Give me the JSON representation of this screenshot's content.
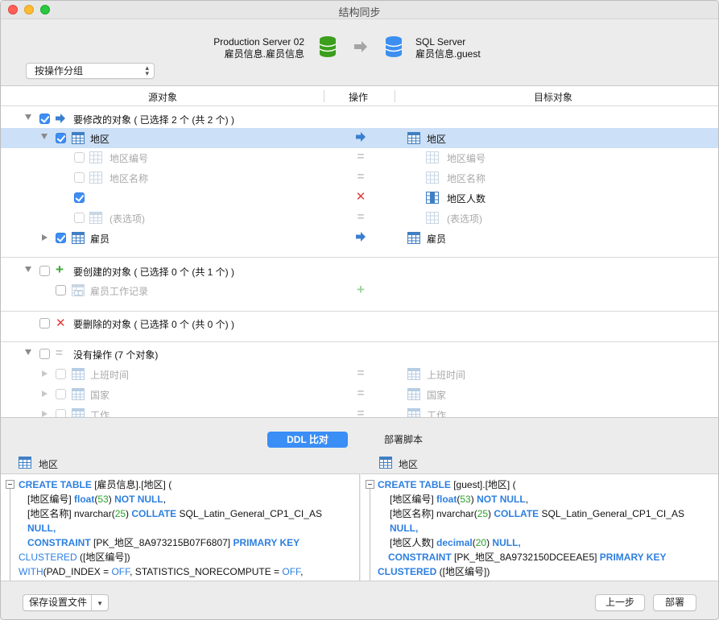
{
  "window": {
    "title": "结构同步"
  },
  "header": {
    "source_server": "Production Server 02",
    "source_schema": "雇员信息.雇员信息",
    "target_server": "SQL Server",
    "target_schema": "雇员信息.guest",
    "group_select": "按操作分组"
  },
  "columns": {
    "source": "源对象",
    "operation": "操作",
    "target": "目标对象"
  },
  "tree": {
    "modify_group": "要修改的对象 ( 已选择 2 个 (共 2 个) )",
    "modify_table": "地区",
    "modify_table_target": "地区",
    "field1": "地区编号",
    "field1_target": "地区编号",
    "field2": "地区名称",
    "field2_target": "地区名称",
    "field3_target": "地区人数",
    "options": "(表选项)",
    "options_target": "(表选项)",
    "employee": "雇员",
    "employee_target": "雇员",
    "create_group": "要创建的对象 ( 已选择 0 个 (共 1 个) )",
    "create_item": "雇员工作记录",
    "delete_group": "要删除的对象 ( 已选择 0 个 (共 0 个) )",
    "noop_group": "没有操作 (7 个对象)",
    "noop1": "上班时间",
    "noop1_target": "上班时间",
    "noop2": "国家",
    "noop2_target": "国家",
    "noop3": "工作",
    "noop3_target": "工作"
  },
  "tabs": {
    "ddl": "DDL 比对",
    "deploy_script": "部署脚本"
  },
  "ddl": {
    "left_title": "地区",
    "right_title": "地区",
    "left": {
      "l1a": "CREATE TABLE",
      "l1b": " [雇员信息].[地区] (",
      "l2a": "[地区编号] ",
      "l2b": "float",
      "l2c": "(",
      "l2d": "53",
      "l2e": ")  ",
      "l2f": "NOT NULL",
      "l3a": "[地区名称] nvarchar(",
      "l3b": "25",
      "l3c": ")  ",
      "l3d": "COLLATE",
      "l3e": " SQL_Latin_General_CP1_CI_AS",
      "l4": "NULL,",
      "l5a": "CONSTRAINT",
      "l5b": " [PK_地区_8A973215B07F6807]  ",
      "l5c": "PRIMARY KEY",
      "l6a": "CLUSTERED",
      "l6b": " ([地区编号])",
      "l7a": "WITH",
      "l7b": "(PAD_INDEX = ",
      "l7c": "OFF",
      "l7d": ", STATISTICS_NORECOMPUTE = ",
      "l7e": "OFF",
      "l7f": ","
    },
    "right": {
      "l1a": "CREATE TABLE",
      "l1b": " [guest].[地区] (",
      "l2a": "[地区编号] ",
      "l2b": "float",
      "l2c": "(",
      "l2d": "53",
      "l2e": ")  ",
      "l2f": "NOT NULL",
      "l3a": "[地区名称] nvarchar(",
      "l3b": "25",
      "l3c": ")  ",
      "l3d": "COLLATE",
      "l3e": " SQL_Latin_General_CP1_CI_AS",
      "l4": "NULL,",
      "l5a": "[地区人数] ",
      "l5b": "decimal",
      "l5c": "(",
      "l5d": "20",
      "l5e": ")  ",
      "l5f": "NULL,",
      "l6a": "CONSTRAINT",
      "l6b": " [PK_地区_8A9732150DCEEAE5]  ",
      "l6c": "PRIMARY KEY",
      "l7a": "CLUSTERED",
      "l7b": " ([地区编号])"
    }
  },
  "footer": {
    "save_settings": "保存设置文件",
    "prev": "上一步",
    "deploy": "部署"
  },
  "colors": {
    "accent": "#3a8ef6",
    "selection": "#cce0f7",
    "add": "#3aaa35",
    "remove": "#e23b3b"
  }
}
